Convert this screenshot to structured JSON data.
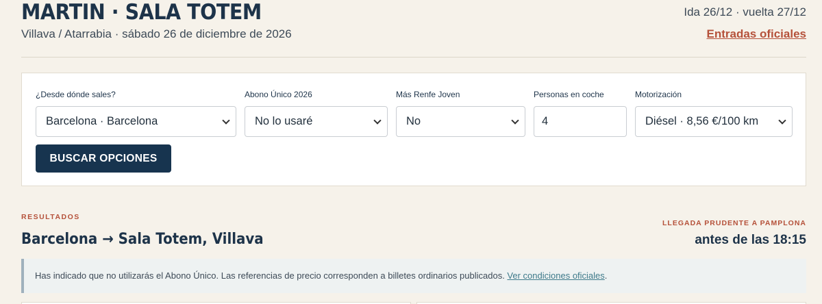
{
  "header": {
    "title": "MARTIN · SALA TOTEM",
    "subtitle": "Villava / Atarrabia · sábado 26 de diciembre de 2026",
    "dates": "Ida 26/12 · vuelta 27/12",
    "official_link": "Entradas oficiales"
  },
  "form": {
    "origin": {
      "label": "¿Desde dónde sales?",
      "value": "Barcelona · Barcelona"
    },
    "abono": {
      "label": "Abono Único 2026",
      "value": "No lo usaré"
    },
    "renfe": {
      "label": "Más Renfe Joven",
      "value": "No"
    },
    "people": {
      "label": "Personas en coche",
      "value": "4"
    },
    "engine": {
      "label": "Motorización",
      "value": "Diésel · 8,56 €/100 km"
    },
    "search_label": "BUSCAR OPCIONES"
  },
  "results": {
    "section_label": "RESULTADOS",
    "route": "Barcelona → Sala Totem, Villava",
    "arrival_label": "LLEGADA PRUDENTE A PAMPLONA",
    "arrival_time": "antes de las 18:15",
    "notice_text": "Has indicado que no utilizarás el Abono Único. Las referencias de precio corresponden a billetes ordinarios publicados. ",
    "notice_link": "Ver condiciones oficiales",
    "notice_end": "."
  },
  "colors": {
    "background": "#f6f2ea",
    "navy": "#17344f",
    "accent": "#b5513a"
  }
}
